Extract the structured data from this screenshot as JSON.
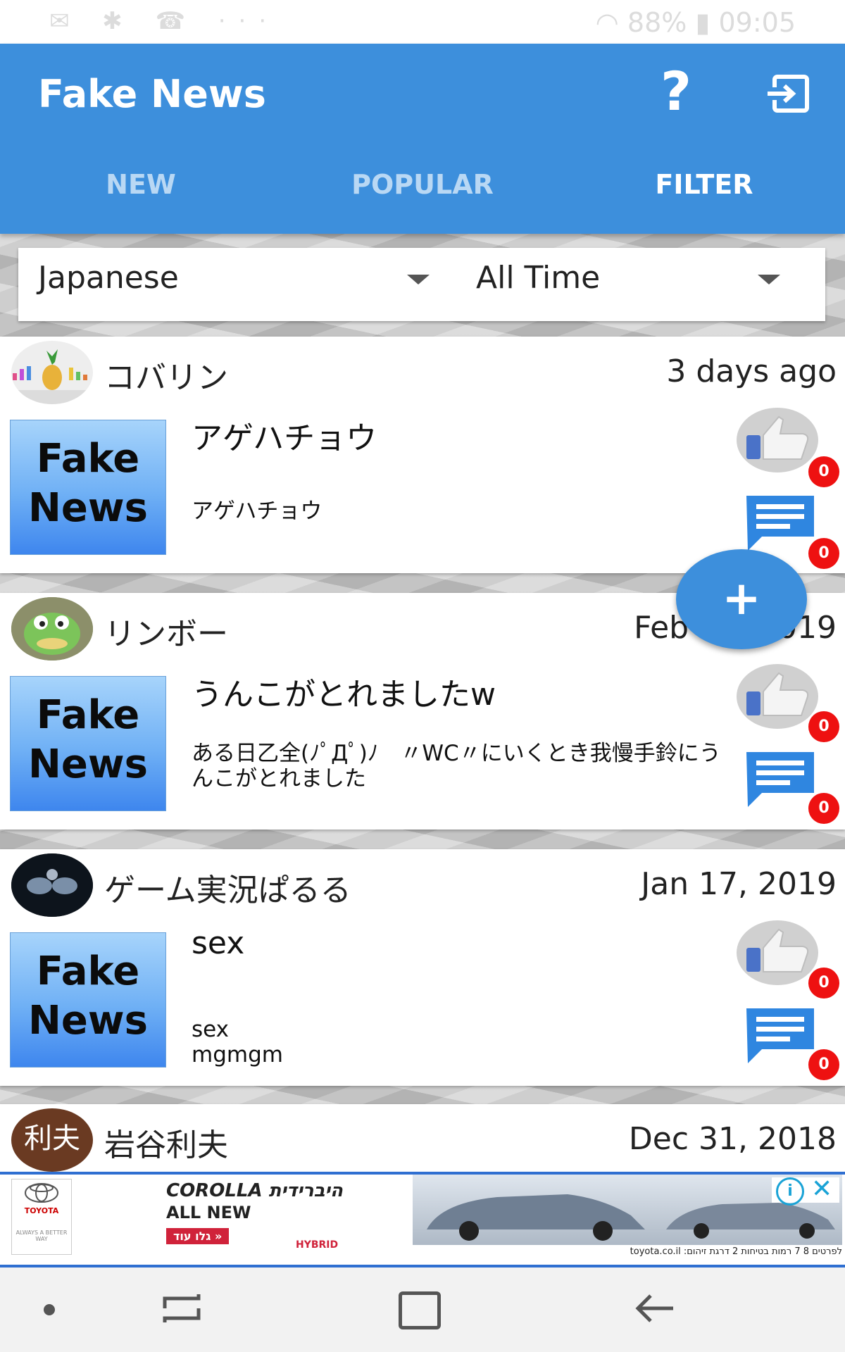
{
  "status_bar": {
    "battery": "88%",
    "time": "09:05"
  },
  "app": {
    "title": "Fake News",
    "help_label": "?"
  },
  "tabs": [
    {
      "label": "NEW",
      "active": false
    },
    {
      "label": "POPULAR",
      "active": false
    },
    {
      "label": "FILTER",
      "active": true
    }
  ],
  "filters": {
    "language": "Japanese",
    "period": "All Time"
  },
  "posts": [
    {
      "user": "コバリン",
      "date": "3 days ago",
      "title": "アゲハチョウ",
      "body": "アゲハチョウ",
      "likes": "0",
      "comments": "0",
      "thumb_line1": "Fake",
      "thumb_line2": "News"
    },
    {
      "user": "リンボー",
      "date": "Feb 19, 2019",
      "title": "うんこがとれましたw",
      "body": "ある日乙全(ﾉﾟДﾟ)ﾉ　〃WC〃にいくとき我慢手鈴にうんこがとれました",
      "likes": "0",
      "comments": "0",
      "thumb_line1": "Fake",
      "thumb_line2": "News"
    },
    {
      "user": "ゲーム実況ぱるる",
      "date": "Jan 17, 2019",
      "title": "sex",
      "body": "sex\nmgmgm",
      "likes": "0",
      "comments": "0",
      "thumb_line1": "Fake",
      "thumb_line2": "News"
    },
    {
      "user": "岩谷利夫",
      "date": "Dec 31, 2018",
      "avatar_text": "利夫"
    }
  ],
  "fab": {
    "label": "+"
  },
  "ad": {
    "brand": "TOYOTA",
    "slogan": "ALWAYS A BETTER WAY",
    "headline_model": "COROLLA",
    "headline_hebrew": "היברידית",
    "headline_sub": "ALL NEW",
    "cta": "גלו עוד »",
    "hybrid": "HYBRID",
    "footer": "toyota.co.il :לפרטים 8 7 רמות בטיחות 2 דרגת זיהום"
  },
  "colors": {
    "primary": "#3d8fdc",
    "badge": "#ee1111"
  }
}
